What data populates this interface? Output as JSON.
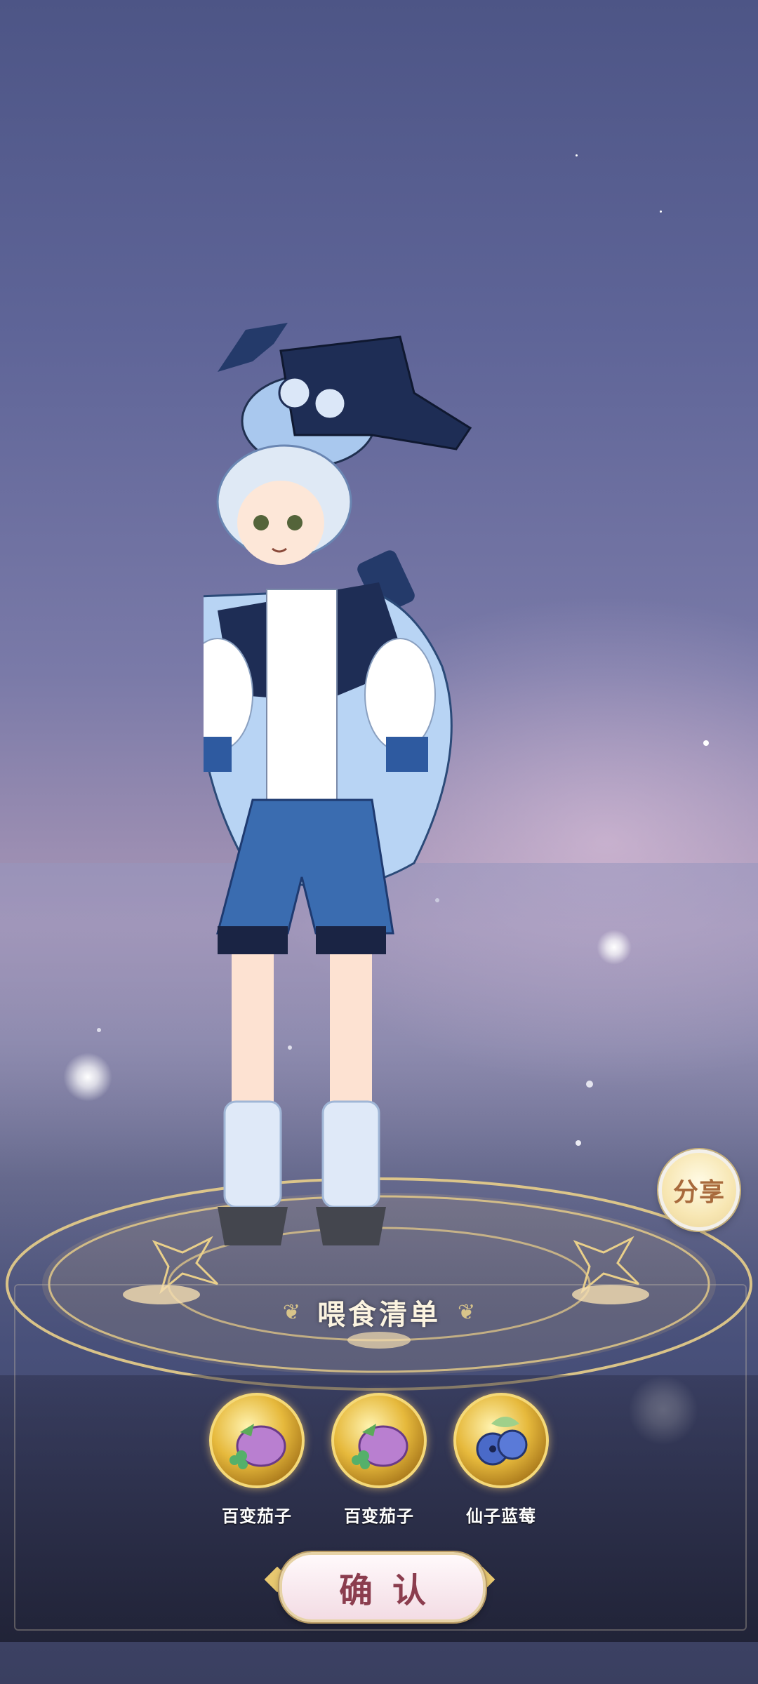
{
  "share_button": {
    "label": "分享"
  },
  "feed_list": {
    "title": "喂食清单",
    "items": [
      {
        "name": "百变茄子",
        "icon": "eggplant-icon"
      },
      {
        "name": "百变茄子",
        "icon": "eggplant-icon"
      },
      {
        "name": "仙子蓝莓",
        "icon": "blueberry-icon"
      }
    ]
  },
  "confirm_button": {
    "label": "确认"
  },
  "colors": {
    "accent_gold": "#e6b93c",
    "confirm_text": "#8b3d4e",
    "share_text": "#a86a3c"
  }
}
